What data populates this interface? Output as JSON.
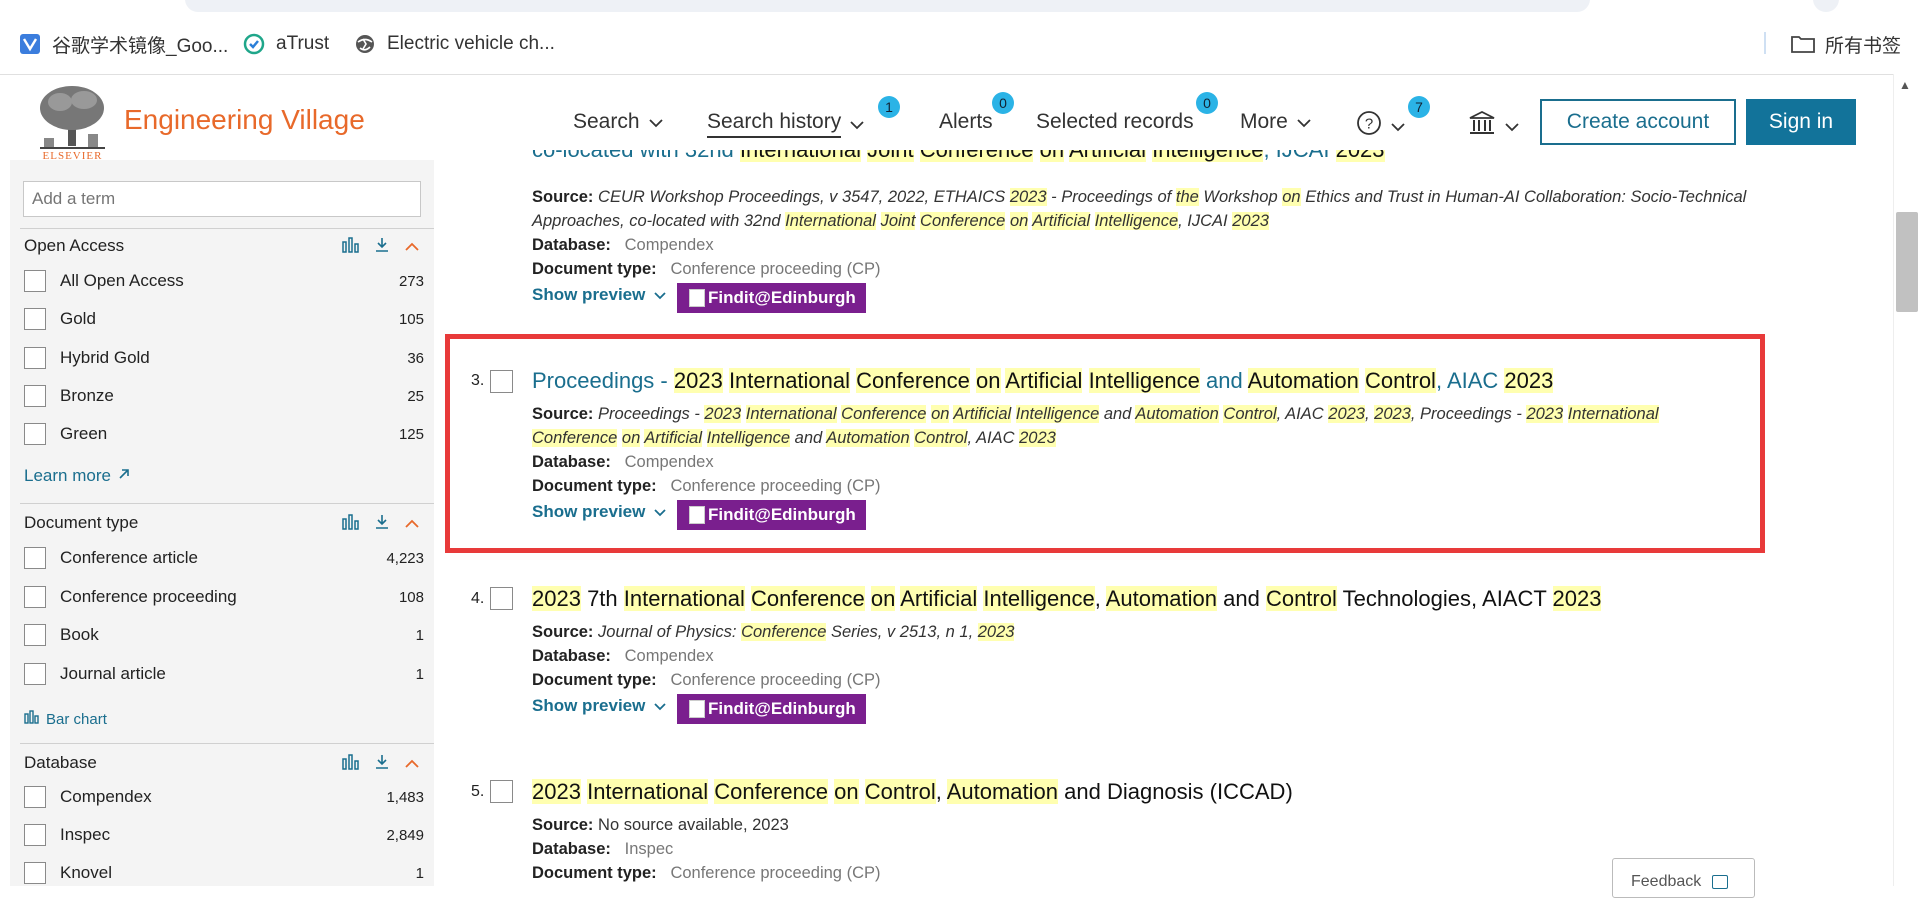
{
  "bookmarks": {
    "items": [
      {
        "label": "谷歌学术镜像_Goo...",
        "icon": "google-scholar-icon"
      },
      {
        "label": "aTrust",
        "icon": "atrust-icon"
      },
      {
        "label": "Electric vehicle ch...",
        "icon": "globe-icon"
      }
    ],
    "all_bookmarks": "所有书签"
  },
  "header": {
    "logo_text": "Engineering Village",
    "logo_caption": "ELSEVIER",
    "nav": {
      "search": "Search",
      "search_history": "Search history",
      "search_history_badge": "1",
      "alerts": "Alerts",
      "alerts_badge": "0",
      "selected_records": "Selected records",
      "selected_records_badge": "0",
      "more": "More",
      "help_badge": "7"
    },
    "create_account": "Create account",
    "sign_in": "Sign in"
  },
  "sidebar": {
    "add_term_placeholder": "Add a term",
    "open_access": {
      "title": "Open Access",
      "items": [
        {
          "label": "All Open Access",
          "count": "273"
        },
        {
          "label": "Gold",
          "count": "105"
        },
        {
          "label": "Hybrid Gold",
          "count": "36"
        },
        {
          "label": "Bronze",
          "count": "25"
        },
        {
          "label": "Green",
          "count": "125"
        }
      ],
      "learn_more": "Learn more"
    },
    "document_type": {
      "title": "Document type",
      "items": [
        {
          "label": "Conference article",
          "count": "4,223"
        },
        {
          "label": "Conference proceeding",
          "count": "108"
        },
        {
          "label": "Book",
          "count": "1"
        },
        {
          "label": "Journal article",
          "count": "1"
        }
      ],
      "bar_chart": "Bar chart"
    },
    "database": {
      "title": "Database",
      "items": [
        {
          "label": "Compendex",
          "count": "1,483"
        },
        {
          "label": "Inspec",
          "count": "2,849"
        },
        {
          "label": "Knovel",
          "count": "1"
        }
      ]
    }
  },
  "labels": {
    "source": "Source:",
    "database": "Database:",
    "document_type": "Document type:",
    "show_preview": "Show preview",
    "findit": "Findit@Edinburgh"
  },
  "results": {
    "r2": {
      "title_partial": "co-located with 32nd International Joint Conference on Artificial Intelligence, IJCAI 2023",
      "source_line1": "CEUR Workshop Proceedings, v 3547, 2022, ETHAICS 2023 - Proceedings of the Workshop on Ethics and Trust in Human-AI Collaboration: Socio-Technical",
      "source_line2": "Approaches, co-located with 32nd International Joint Conference on Artificial Intelligence, IJCAI 2023",
      "database": "Compendex",
      "doc_type": "Conference proceeding (CP)"
    },
    "r3": {
      "number": "3.",
      "title": "Proceedings - 2023 International Conference on Artificial Intelligence and Automation Control, AIAC 2023",
      "source_line1": "Proceedings - 2023 International Conference on Artificial Intelligence and Automation Control, AIAC 2023, 2023, Proceedings - 2023 International",
      "source_line2": "Conference on Artificial Intelligence and Automation Control, AIAC 2023",
      "database": "Compendex",
      "doc_type": "Conference proceeding (CP)"
    },
    "r4": {
      "number": "4.",
      "title": "2023 7th International Conference on Artificial Intelligence, Automation and Control Technologies, AIACT 2023",
      "source": "Journal of Physics: Conference Series, v 2513, n 1, 2023",
      "database": "Compendex",
      "doc_type": "Conference proceeding (CP)"
    },
    "r5": {
      "number": "5.",
      "title": "2023 International Conference on Control, Automation and Diagnosis (ICCAD)",
      "source": "No source available, 2023",
      "database": "Inspec",
      "doc_type": "Conference proceeding (CP)"
    }
  },
  "feedback": "Feedback"
}
